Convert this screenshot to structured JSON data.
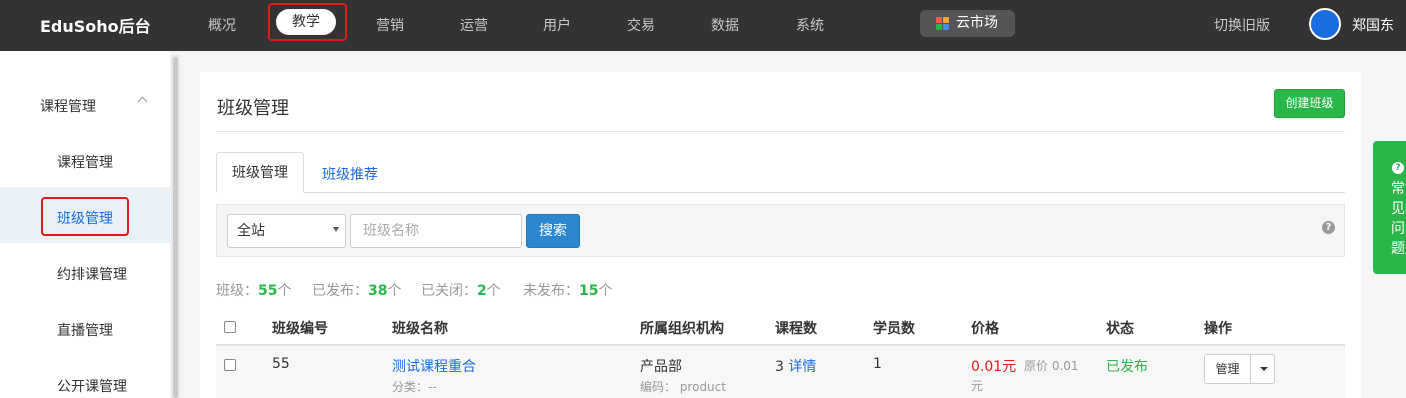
{
  "header": {
    "brand": "EduSoho后台",
    "nav": [
      "概况",
      "教学",
      "营销",
      "运营",
      "用户",
      "交易",
      "数据",
      "系统"
    ],
    "active_nav": "教学",
    "cloud_market": "云市场",
    "switch_old": "切换旧版",
    "username": "郑国东"
  },
  "sidebar": {
    "group_title": "课程管理",
    "items": [
      "课程管理",
      "班级管理",
      "约排课管理",
      "直播管理",
      "公开课管理"
    ],
    "active_item": "班级管理"
  },
  "main": {
    "title": "班级管理",
    "create_button": "创建班级",
    "tabs": [
      "班级管理",
      "班级推荐"
    ],
    "filter": {
      "select_value": "全站",
      "search_placeholder": "班级名称",
      "search_button": "搜索"
    },
    "stats": {
      "classes_label": "班级：",
      "classes_count": "55",
      "classes_unit": "个",
      "published_label": "已发布：",
      "published_count": "38",
      "published_unit": "个",
      "closed_label": "已关闭：",
      "closed_count": "2",
      "closed_unit": "个",
      "unpublished_label": "未发布：",
      "unpublished_count": "15",
      "unpublished_unit": "个"
    },
    "table": {
      "headers": [
        "班级编号",
        "班级名称",
        "所属组织机构",
        "课程数",
        "学员数",
        "价格",
        "状态",
        "操作"
      ],
      "rows": [
        {
          "id": "55",
          "name": "测试课程重合",
          "category": "分类：--",
          "org": "产品部",
          "org_code": "编码： product",
          "course_count": "3",
          "course_detail": "详情",
          "students": "1",
          "price": "0.01元",
          "original_price": "原价 0.01",
          "original_price_unit": "元",
          "status": "已发布",
          "action": "管理"
        }
      ]
    }
  },
  "faq_tab": {
    "label": "常见问题",
    "icon": "?"
  },
  "colors": {
    "accent": "#1a6de0",
    "green": "#2bb64a",
    "red": "#e0191a",
    "topbar": "#333333"
  }
}
